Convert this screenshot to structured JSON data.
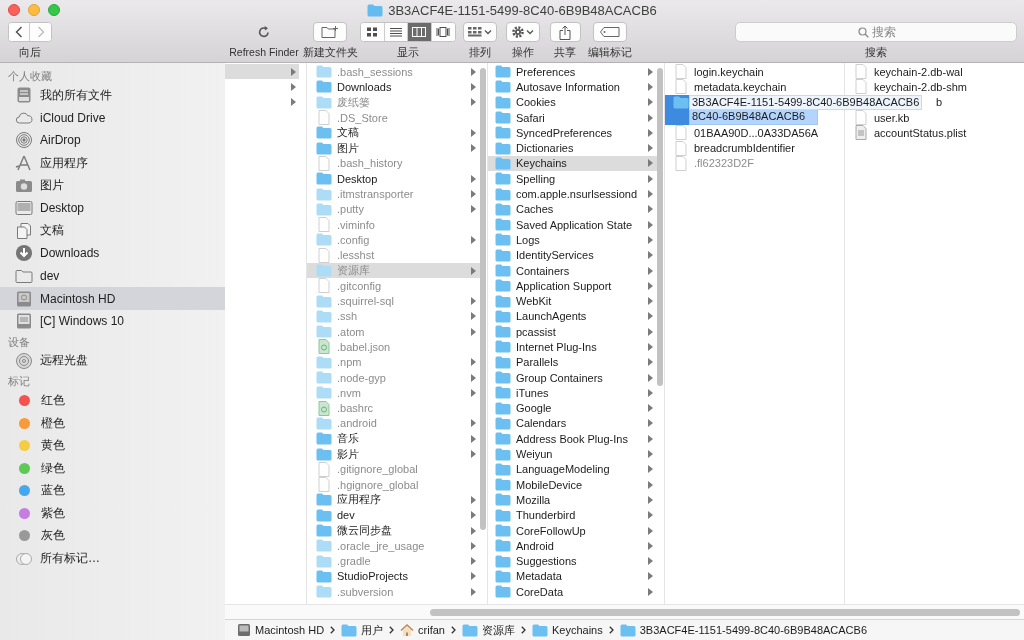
{
  "window": {
    "title": "3B3ACF4E-1151-5499-8C40-6B9B48ACACB6"
  },
  "toolbar": {
    "back": {
      "disabled": false
    },
    "forward": {
      "disabled": true
    },
    "nav_label": "向后",
    "items": [
      {
        "kind": "refresh",
        "label": "Refresh Finder"
      },
      {
        "kind": "new_folder",
        "label": "新建文件夹"
      },
      {
        "kind": "view",
        "label": "显示",
        "modes": [
          {
            "kind": "icons",
            "selected": false
          },
          {
            "kind": "list",
            "selected": false
          },
          {
            "kind": "columns",
            "selected": true
          },
          {
            "kind": "cover_flow",
            "selected": false
          }
        ]
      },
      {
        "kind": "arrange",
        "label": "排列"
      },
      {
        "kind": "action",
        "label": "操作"
      },
      {
        "kind": "share",
        "label": "共享"
      },
      {
        "kind": "tags",
        "label": "编辑标记"
      }
    ],
    "search": {
      "placeholder": "搜索",
      "label": "搜索"
    }
  },
  "sidebar": {
    "sections": [
      {
        "title": "个人收藏",
        "items": [
          {
            "kind": "all_files",
            "label": "我的所有文件",
            "selected": false
          },
          {
            "kind": "icloud",
            "label": "iCloud Drive",
            "selected": false
          },
          {
            "kind": "airdrop",
            "label": "AirDrop",
            "selected": false
          },
          {
            "kind": "apps",
            "label": "应用程序",
            "selected": false
          },
          {
            "kind": "pictures",
            "label": "图片",
            "selected": false
          },
          {
            "kind": "desktop",
            "label": "Desktop",
            "selected": false
          },
          {
            "kind": "documents",
            "label": "文稿",
            "selected": false
          },
          {
            "kind": "downloads",
            "label": "Downloads",
            "selected": false
          },
          {
            "kind": "folder",
            "label": "dev",
            "selected": false
          },
          {
            "kind": "disk",
            "label": "Macintosh HD",
            "selected": true
          },
          {
            "kind": "windows_disk",
            "label": "[C] Windows 10",
            "selected": false
          }
        ]
      },
      {
        "title": "设备",
        "items": [
          {
            "kind": "optical_disc",
            "label": "远程光盘",
            "selected": false
          }
        ]
      },
      {
        "title": "标记",
        "items": [
          {
            "kind": "tag",
            "label": "红色",
            "color": "#f4514f",
            "selected": false
          },
          {
            "kind": "tag",
            "label": "橙色",
            "color": "#f79a3c",
            "selected": false
          },
          {
            "kind": "tag",
            "label": "黄色",
            "color": "#f5cd45",
            "selected": false
          },
          {
            "kind": "tag",
            "label": "绿色",
            "color": "#5ccb55",
            "selected": false
          },
          {
            "kind": "tag",
            "label": "蓝色",
            "color": "#45a8ef",
            "selected": false
          },
          {
            "kind": "tag",
            "label": "紫色",
            "color": "#c57de0",
            "selected": false
          },
          {
            "kind": "tag",
            "label": "灰色",
            "color": "#999999",
            "selected": false
          },
          {
            "kind": "all_tags",
            "label": "所有标记…",
            "selected": false
          }
        ]
      }
    ]
  },
  "browser": {
    "columns": [
      {
        "active": false,
        "items": [
          {
            "selected": true,
            "has_children": true
          },
          {
            "selected": false,
            "has_children": true
          },
          {
            "selected": false,
            "has_children": true
          }
        ]
      },
      {
        "active": false,
        "items": [
          {
            "name": ".bash_sessions",
            "kind": "folder",
            "dimmed": true,
            "has_children": true,
            "selected": false
          },
          {
            "name": "Downloads",
            "kind": "folder",
            "dimmed": false,
            "has_children": true,
            "selected": false
          },
          {
            "name": "废纸篓",
            "kind": "folder",
            "dimmed": true,
            "has_children": true,
            "selected": false
          },
          {
            "name": ".DS_Store",
            "kind": "file",
            "dimmed": true,
            "has_children": false,
            "selected": false
          },
          {
            "name": "文稿",
            "kind": "folder",
            "dimmed": false,
            "has_children": true,
            "selected": false
          },
          {
            "name": "图片",
            "kind": "folder",
            "dimmed": false,
            "has_children": true,
            "selected": false
          },
          {
            "name": ".bash_history",
            "kind": "file",
            "dimmed": true,
            "has_children": false,
            "selected": false
          },
          {
            "name": "Desktop",
            "kind": "folder",
            "dimmed": false,
            "has_children": true,
            "selected": false
          },
          {
            "name": ".itmstransporter",
            "kind": "folder",
            "dimmed": true,
            "has_children": true,
            "selected": false
          },
          {
            "name": ".putty",
            "kind": "folder",
            "dimmed": true,
            "has_children": true,
            "selected": false
          },
          {
            "name": ".viminfo",
            "kind": "file",
            "dimmed": true,
            "has_children": false,
            "selected": false
          },
          {
            "name": ".config",
            "kind": "folder",
            "dimmed": true,
            "has_children": true,
            "selected": false
          },
          {
            "name": ".lesshst",
            "kind": "file",
            "dimmed": true,
            "has_children": false,
            "selected": false
          },
          {
            "name": "资源库",
            "kind": "folder",
            "dimmed": true,
            "has_children": true,
            "selected": true
          },
          {
            "name": ".gitconfig",
            "kind": "file",
            "dimmed": true,
            "has_children": false,
            "selected": false
          },
          {
            "name": ".squirrel-sql",
            "kind": "folder",
            "dimmed": true,
            "has_children": true,
            "selected": false
          },
          {
            "name": ".ssh",
            "kind": "folder",
            "dimmed": true,
            "has_children": true,
            "selected": false
          },
          {
            "name": ".atom",
            "kind": "folder",
            "dimmed": true,
            "has_children": true,
            "selected": false
          },
          {
            "name": ".babel.json",
            "kind": "code",
            "dimmed": true,
            "has_children": false,
            "selected": false
          },
          {
            "name": ".npm",
            "kind": "folder",
            "dimmed": true,
            "has_children": true,
            "selected": false
          },
          {
            "name": ".node-gyp",
            "kind": "folder",
            "dimmed": true,
            "has_children": true,
            "selected": false
          },
          {
            "name": ".nvm",
            "kind": "folder",
            "dimmed": true,
            "has_children": true,
            "selected": false
          },
          {
            "name": ".bashrc",
            "kind": "code",
            "dimmed": true,
            "has_children": false,
            "selected": false
          },
          {
            "name": ".android",
            "kind": "folder",
            "dimmed": true,
            "has_children": true,
            "selected": false
          },
          {
            "name": "音乐",
            "kind": "folder",
            "dimmed": false,
            "has_children": true,
            "selected": false
          },
          {
            "name": "影片",
            "kind": "folder",
            "dimmed": false,
            "has_children": true,
            "selected": false
          },
          {
            "name": ".gitignore_global",
            "kind": "file",
            "dimmed": true,
            "has_children": false,
            "selected": false
          },
          {
            "name": ".hgignore_global",
            "kind": "file",
            "dimmed": true,
            "has_children": false,
            "selected": false
          },
          {
            "name": "应用程序",
            "kind": "folder",
            "dimmed": false,
            "has_children": true,
            "selected": false
          },
          {
            "name": "dev",
            "kind": "folder",
            "dimmed": false,
            "has_children": true,
            "selected": false
          },
          {
            "name": "微云同步盘",
            "kind": "folder",
            "dimmed": false,
            "has_children": true,
            "selected": false
          },
          {
            "name": ".oracle_jre_usage",
            "kind": "folder",
            "dimmed": true,
            "has_children": true,
            "selected": false
          },
          {
            "name": ".gradle",
            "kind": "folder",
            "dimmed": true,
            "has_children": true,
            "selected": false
          },
          {
            "name": "StudioProjects",
            "kind": "folder",
            "dimmed": false,
            "has_children": true,
            "selected": false
          },
          {
            "name": ".subversion",
            "kind": "folder",
            "dimmed": true,
            "has_children": true,
            "selected": false
          }
        ]
      },
      {
        "active": false,
        "items": [
          {
            "name": "Preferences",
            "kind": "folder",
            "has_children": true,
            "selected": false
          },
          {
            "name": "Autosave Information",
            "kind": "folder",
            "has_children": true,
            "selected": false
          },
          {
            "name": "Cookies",
            "kind": "folder",
            "has_children": true,
            "selected": false
          },
          {
            "name": "Safari",
            "kind": "folder",
            "has_children": true,
            "selected": false
          },
          {
            "name": "SyncedPreferences",
            "kind": "folder",
            "has_children": true,
            "selected": false
          },
          {
            "name": "Dictionaries",
            "kind": "folder",
            "has_children": true,
            "selected": false
          },
          {
            "name": "Keychains",
            "kind": "folder",
            "has_children": true,
            "selected": true
          },
          {
            "name": "Spelling",
            "kind": "folder",
            "has_children": true,
            "selected": false
          },
          {
            "name": "com.apple.nsurlsessiond",
            "kind": "folder",
            "has_children": true,
            "selected": false
          },
          {
            "name": "Caches",
            "kind": "folder",
            "has_children": true,
            "selected": false
          },
          {
            "name": "Saved Application State",
            "kind": "folder",
            "has_children": true,
            "selected": false
          },
          {
            "name": "Logs",
            "kind": "folder",
            "has_children": true,
            "selected": false
          },
          {
            "name": "IdentityServices",
            "kind": "folder",
            "has_children": true,
            "selected": false
          },
          {
            "name": "Containers",
            "kind": "folder",
            "has_children": true,
            "selected": false
          },
          {
            "name": "Application Support",
            "kind": "folder",
            "has_children": true,
            "selected": false
          },
          {
            "name": "WebKit",
            "kind": "folder",
            "has_children": true,
            "selected": false
          },
          {
            "name": "LaunchAgents",
            "kind": "folder",
            "has_children": true,
            "selected": false
          },
          {
            "name": "pcassist",
            "kind": "folder",
            "has_children": true,
            "selected": false
          },
          {
            "name": "Internet Plug-Ins",
            "kind": "folder",
            "has_children": true,
            "selected": false
          },
          {
            "name": "Parallels",
            "kind": "folder",
            "has_children": true,
            "selected": false
          },
          {
            "name": "Group Containers",
            "kind": "folder",
            "has_children": true,
            "selected": false
          },
          {
            "name": "iTunes",
            "kind": "folder",
            "has_children": true,
            "selected": false
          },
          {
            "name": "Google",
            "kind": "folder",
            "has_children": true,
            "selected": false
          },
          {
            "name": "Calendars",
            "kind": "folder",
            "has_children": true,
            "selected": false
          },
          {
            "name": "Address Book Plug-Ins",
            "kind": "folder",
            "has_children": true,
            "selected": false
          },
          {
            "name": "Weiyun",
            "kind": "folder",
            "has_children": true,
            "selected": false
          },
          {
            "name": "LanguageModeling",
            "kind": "folder",
            "has_children": true,
            "selected": false
          },
          {
            "name": "MobileDevice",
            "kind": "folder",
            "has_children": true,
            "selected": false
          },
          {
            "name": "Mozilla",
            "kind": "folder",
            "has_children": true,
            "selected": false
          },
          {
            "name": "Thunderbird",
            "kind": "folder",
            "has_children": true,
            "selected": false
          },
          {
            "name": "CoreFollowUp",
            "kind": "folder",
            "has_children": true,
            "selected": false
          },
          {
            "name": "Android",
            "kind": "folder",
            "has_children": true,
            "selected": false
          },
          {
            "name": "Suggestions",
            "kind": "folder",
            "has_children": true,
            "selected": false
          },
          {
            "name": "Metadata",
            "kind": "folder",
            "has_children": true,
            "selected": false
          },
          {
            "name": "CoreData",
            "kind": "folder",
            "has_children": true,
            "selected": false
          }
        ]
      },
      {
        "active": true,
        "items": [
          {
            "name": "login.keychain",
            "kind": "file",
            "dimmed": false,
            "selected": false
          },
          {
            "name": "metadata.keychain",
            "kind": "file",
            "dimmed": false,
            "selected": false
          },
          {
            "name": "3B3ACF4E-1151-5499-8C40-6B9B48ACACB6",
            "rename_tail": "8C40-6B9B48ACACB6",
            "kind": "folder",
            "dimmed": false,
            "selected": true
          },
          {
            "name": "01BAA90D...0A33DA56A",
            "kind": "file",
            "dimmed": false,
            "selected": false
          },
          {
            "name": "breadcrumbIdentifier",
            "kind": "file",
            "dimmed": false,
            "selected": false
          },
          {
            "name": ".fl62323D2F",
            "kind": "file",
            "dimmed": true,
            "selected": false
          }
        ]
      },
      {
        "items": [
          {
            "name": "keychain-2.db-wal",
            "kind": "file",
            "selected": false
          },
          {
            "name": "keychain-2.db-shm",
            "kind": "file",
            "selected": false
          },
          {
            "name": "b",
            "kind": "partial",
            "selected": false
          },
          {
            "name": "user.kb",
            "kind": "file",
            "selected": false
          },
          {
            "name": "accountStatus.plist",
            "kind": "plist",
            "selected": false
          }
        ]
      }
    ]
  },
  "path_bar": [
    {
      "kind": "disk",
      "label": "Macintosh HD"
    },
    {
      "kind": "folder",
      "label": "用户"
    },
    {
      "kind": "home",
      "label": "crifan"
    },
    {
      "kind": "folder",
      "label": "资源库"
    },
    {
      "kind": "folder",
      "label": "Keychains"
    },
    {
      "kind": "folder",
      "label": "3B3ACF4E-1151-5499-8C40-6B9B48ACACB6"
    }
  ]
}
